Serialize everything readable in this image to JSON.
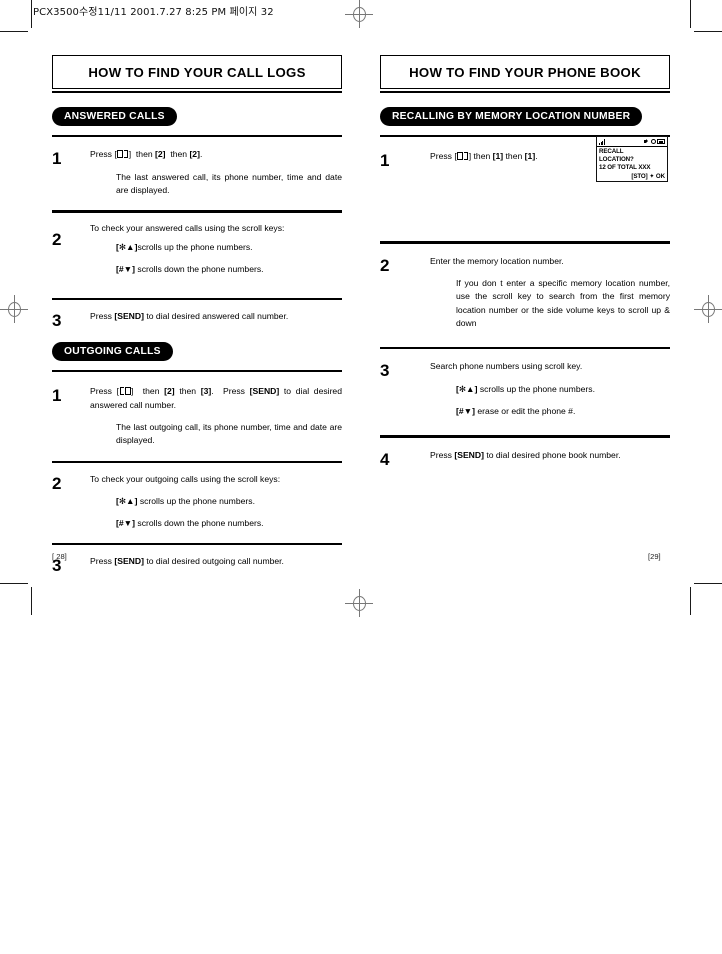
{
  "scan_header": "PCX3500수정11/11  2001.7.27 8:25 PM  페이지 32",
  "left_page": {
    "title": "HOW TO FIND YOUR CALL LOGS",
    "folio": "[ 28]",
    "sections": [
      {
        "tag": "ANSWERED CALLS",
        "steps": [
          {
            "num": "1",
            "lines": [
              "Press [<book>] then [2] then [2].",
              "The last answered call, its phone number, time and date are displayed."
            ]
          },
          {
            "num": "2",
            "lines": [
              "To check your answered calls using the scroll keys:",
              "[✻▲]scrolls up the phone numbers.",
              "[#▼] scrolls down the phone numbers."
            ]
          },
          {
            "num": "3",
            "lines": [
              "Press [SEND] to dial desired answered call number."
            ]
          }
        ]
      },
      {
        "tag": "OUTGOING CALLS",
        "steps": [
          {
            "num": "1",
            "lines": [
              "Press [<book>] then [2] then [3]. Press [SEND] to dial desired answered call number.",
              "The last outgoing call, its phone number, time and date are displayed."
            ]
          },
          {
            "num": "2",
            "lines": [
              "To check your outgoing calls using the scroll keys:",
              "[✻▲] scrolls up the phone numbers.",
              "[#▼] scrolls down the phone numbers."
            ]
          },
          {
            "num": "3",
            "lines": [
              "Press [SEND] to dial desired outgoing call number."
            ]
          }
        ]
      }
    ]
  },
  "right_page": {
    "title": "HOW TO FIND YOUR PHONE BOOK",
    "folio": "[29]",
    "sections": [
      {
        "tag": "RECALLING BY MEMORY LOCATION NUMBER",
        "steps": [
          {
            "num": "1",
            "lines": [
              "Press [<book>] then [1] then [1]."
            ]
          },
          {
            "num": "2",
            "lines": [
              "Enter the memory location number.",
              "If you don t enter a specific memory location number, use the scroll key to search from the first memory location number or the side volume keys to scroll up & down"
            ]
          },
          {
            "num": "3",
            "lines": [
              "Search phone numbers using scroll key.",
              "[✻▲] scrolls up the phone numbers.",
              "[#▼] erase or edit the phone #."
            ]
          },
          {
            "num": "4",
            "lines": [
              "Press [SEND] to dial desired phone book number."
            ]
          }
        ]
      }
    ],
    "lcd": {
      "line1": "RECALL",
      "line2": "LOCATION?",
      "line3": "12 OF TOTAL XXX",
      "line4": "[STO] ✦ OK",
      "icons": [
        "signal-icon",
        "speaker-icon",
        "clock-icon",
        "battery-icon"
      ]
    }
  }
}
